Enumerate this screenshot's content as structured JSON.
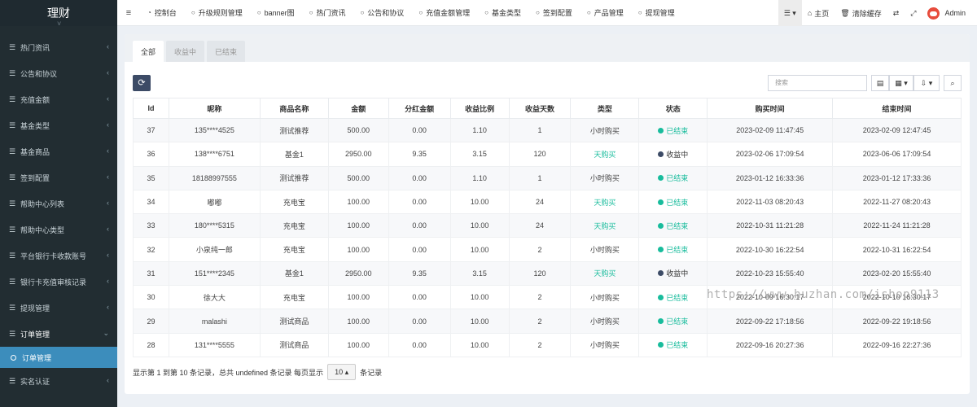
{
  "sidebar": {
    "title": "理财",
    "items": [
      {
        "label": "热门资讯"
      },
      {
        "label": "公告和协议"
      },
      {
        "label": "充值金额"
      },
      {
        "label": "基金类型"
      },
      {
        "label": "基金商品"
      },
      {
        "label": "签到配置"
      },
      {
        "label": "帮助中心列表"
      },
      {
        "label": "帮助中心类型"
      },
      {
        "label": "平台银行卡收款账号"
      },
      {
        "label": "银行卡充值审核记录"
      },
      {
        "label": "提现管理"
      },
      {
        "label": "订单管理"
      }
    ],
    "active_sub": "订单管理",
    "last_item": "实名认证"
  },
  "topnav": {
    "items": [
      "控制台",
      "升级规则管理",
      "banner图",
      "热门资讯",
      "公告和协议",
      "充值金额管理",
      "基金类型",
      "签到配置",
      "产品管理",
      "提现管理"
    ],
    "home": "主页",
    "clear_cache": "清除缓存",
    "user": "Admin"
  },
  "tabs": [
    "全部",
    "收益中",
    "已结束"
  ],
  "search": {
    "placeholder": "搜索"
  },
  "table": {
    "headers": [
      "Id",
      "昵称",
      "商品名称",
      "金额",
      "分红金额",
      "收益比例",
      "收益天数",
      "类型",
      "状态",
      "购买时间",
      "结束时间"
    ],
    "rows": [
      {
        "id": "37",
        "nick": "135****4525",
        "product": "测试推荐",
        "amount": "500.00",
        "bonus": "0.00",
        "ratio": "1.10",
        "days": "1",
        "type": "小时购买",
        "status": "已结束",
        "buy": "2023-02-09 11:47:45",
        "end": "2023-02-09 12:47:45"
      },
      {
        "id": "36",
        "nick": "138****6751",
        "product": "基金1",
        "amount": "2950.00",
        "bonus": "9.35",
        "ratio": "3.15",
        "days": "120",
        "type": "天购买",
        "status": "收益中",
        "buy": "2023-02-06 17:09:54",
        "end": "2023-06-06 17:09:54"
      },
      {
        "id": "35",
        "nick": "18188997555",
        "product": "测试推荐",
        "amount": "500.00",
        "bonus": "0.00",
        "ratio": "1.10",
        "days": "1",
        "type": "小时购买",
        "status": "已结束",
        "buy": "2023-01-12 16:33:36",
        "end": "2023-01-12 17:33:36"
      },
      {
        "id": "34",
        "nick": "嘟嘟",
        "product": "充电宝",
        "amount": "100.00",
        "bonus": "0.00",
        "ratio": "10.00",
        "days": "24",
        "type": "天购买",
        "status": "已结束",
        "buy": "2022-11-03 08:20:43",
        "end": "2022-11-27 08:20:43"
      },
      {
        "id": "33",
        "nick": "180****5315",
        "product": "充电宝",
        "amount": "100.00",
        "bonus": "0.00",
        "ratio": "10.00",
        "days": "24",
        "type": "天购买",
        "status": "已结束",
        "buy": "2022-10-31 11:21:28",
        "end": "2022-11-24 11:21:28"
      },
      {
        "id": "32",
        "nick": "小泉纯一郎",
        "product": "充电宝",
        "amount": "100.00",
        "bonus": "0.00",
        "ratio": "10.00",
        "days": "2",
        "type": "小时购买",
        "status": "已结束",
        "buy": "2022-10-30 16:22:54",
        "end": "2022-10-31 16:22:54"
      },
      {
        "id": "31",
        "nick": "151****2345",
        "product": "基金1",
        "amount": "2950.00",
        "bonus": "9.35",
        "ratio": "3.15",
        "days": "120",
        "type": "天购买",
        "status": "收益中",
        "buy": "2022-10-23 15:55:40",
        "end": "2023-02-20 15:55:40"
      },
      {
        "id": "30",
        "nick": "徐大大",
        "product": "充电宝",
        "amount": "100.00",
        "bonus": "0.00",
        "ratio": "10.00",
        "days": "2",
        "type": "小时购买",
        "status": "已结束",
        "buy": "2022-10-09 16:30:17",
        "end": "2022-10-10 16:30:17"
      },
      {
        "id": "29",
        "nick": "malashi",
        "product": "测试商品",
        "amount": "100.00",
        "bonus": "0.00",
        "ratio": "10.00",
        "days": "2",
        "type": "小时购买",
        "status": "已结束",
        "buy": "2022-09-22 17:18:56",
        "end": "2022-09-22 19:18:56"
      },
      {
        "id": "28",
        "nick": "131****5555",
        "product": "测试商品",
        "amount": "100.00",
        "bonus": "0.00",
        "ratio": "10.00",
        "days": "2",
        "type": "小时购买",
        "status": "已结束",
        "buy": "2022-09-16 20:27:36",
        "end": "2022-09-16 22:27:36"
      }
    ]
  },
  "footer": {
    "summary": "显示第 1 到第 10 条记录，总共 undefined 条记录 每页显示",
    "page_size": "10",
    "suffix": "条记录"
  },
  "watermark": "https://www.huzhan.com/ishop9113",
  "colors": {
    "sidebar": "#222d32",
    "active": "#3c8dbc",
    "green": "#18bc9c",
    "navy": "#3c4b66"
  }
}
